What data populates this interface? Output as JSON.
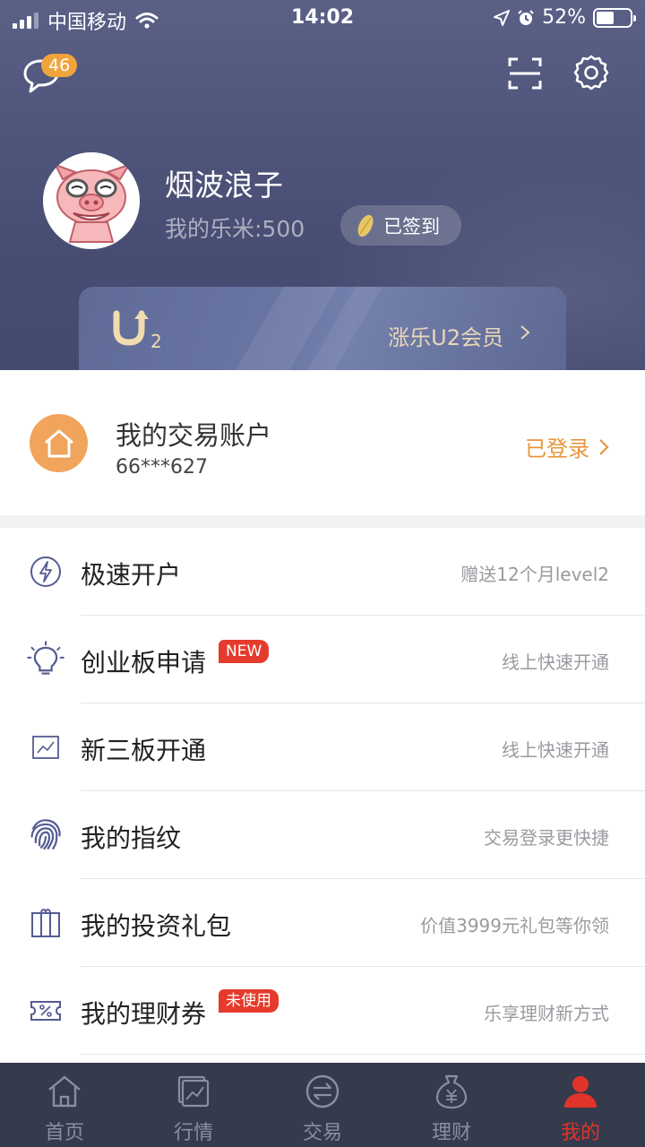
{
  "status_bar": {
    "carrier": "中国移动",
    "time": "14:02",
    "battery": "52%"
  },
  "header": {
    "message_count": "46",
    "user_name": "烟波浪子",
    "points": "我的乐米:500",
    "signin_label": "已签到",
    "member_label": "涨乐U2会员",
    "member_logo_text": "2"
  },
  "account": {
    "title": "我的交易账户",
    "number": "66***627",
    "status": "已登录"
  },
  "menu": [
    {
      "label": "极速开户",
      "sub": "赠送12个月level2",
      "tag": ""
    },
    {
      "label": "创业板申请",
      "sub": "线上快速开通",
      "tag": "NEW"
    },
    {
      "label": "新三板开通",
      "sub": "线上快速开通",
      "tag": ""
    },
    {
      "label": "我的指纹",
      "sub": "交易登录更快捷",
      "tag": ""
    },
    {
      "label": "我的投资礼包",
      "sub": "价值3999元礼包等你领",
      "tag": ""
    },
    {
      "label": "我的理财券",
      "sub": "乐享理财新方式",
      "tag": "未使用"
    }
  ],
  "tabs": [
    {
      "label": "首页"
    },
    {
      "label": "行情"
    },
    {
      "label": "交易"
    },
    {
      "label": "理财"
    },
    {
      "label": "我的"
    }
  ],
  "colors": {
    "accent": "#e0342a",
    "orange": "#e8963d",
    "header_bg": "#4f557b",
    "tabbar_bg": "#353a4d"
  }
}
